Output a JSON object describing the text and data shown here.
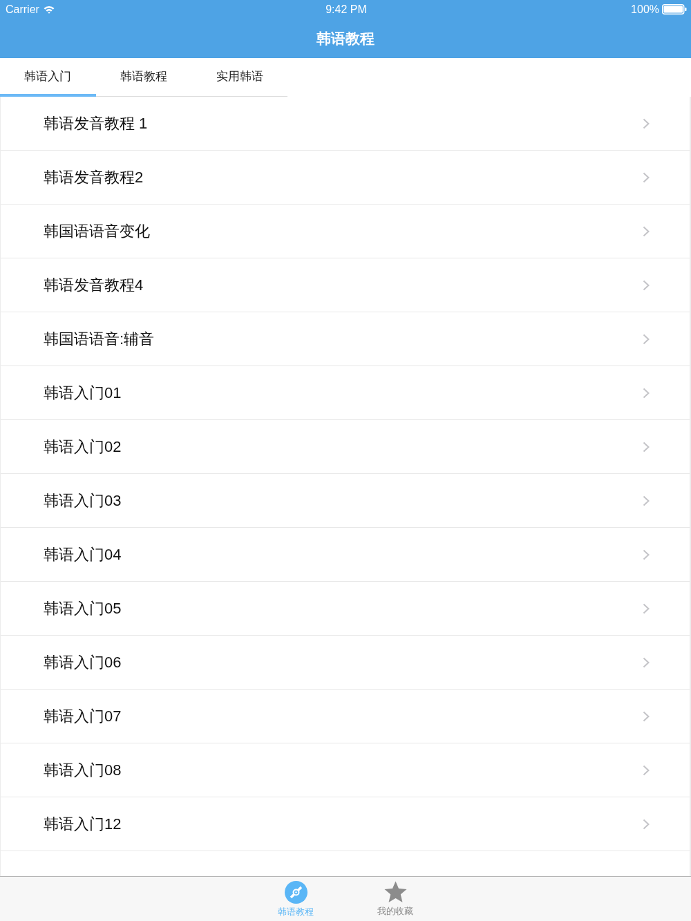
{
  "status_bar": {
    "carrier": "Carrier",
    "time": "9:42 PM",
    "battery": "100%"
  },
  "nav_bar": {
    "title": "韩语教程"
  },
  "tabs": [
    {
      "label": "韩语入门",
      "selected": true
    },
    {
      "label": "韩语教程",
      "selected": false
    },
    {
      "label": "实用韩语",
      "selected": false
    }
  ],
  "list": {
    "items": [
      {
        "title": "韩语发音教程 1"
      },
      {
        "title": "韩语发音教程2"
      },
      {
        "title": "韩国语语音变化"
      },
      {
        "title": "韩语发音教程4"
      },
      {
        "title": "韩国语语音:辅音"
      },
      {
        "title": "韩语入门01"
      },
      {
        "title": "韩语入门02"
      },
      {
        "title": "韩语入门03"
      },
      {
        "title": "韩语入门04"
      },
      {
        "title": "韩语入门05"
      },
      {
        "title": "韩语入门06"
      },
      {
        "title": "韩语入门07"
      },
      {
        "title": "韩语入门08"
      },
      {
        "title": "韩语入门12"
      }
    ]
  },
  "tab_bar": {
    "items": [
      {
        "label": "韩语教程",
        "kind": "disc",
        "selected": true
      },
      {
        "label": "我的收藏",
        "kind": "star",
        "selected": false
      }
    ]
  }
}
